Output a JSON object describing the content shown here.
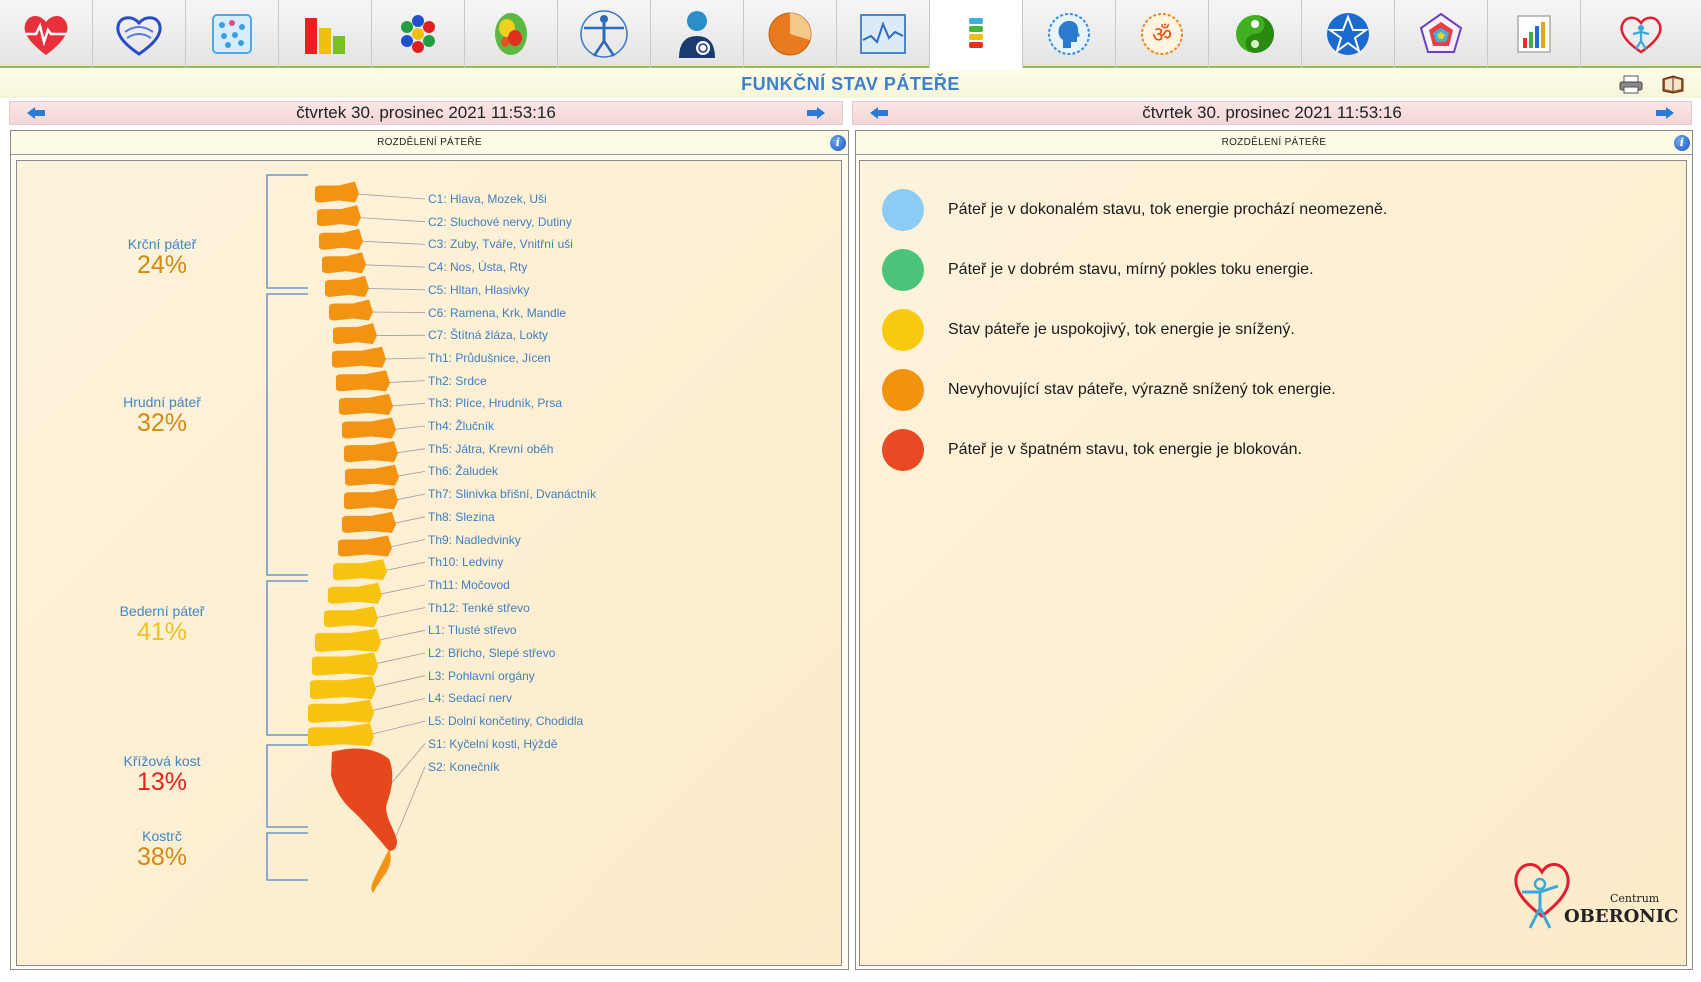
{
  "header": {
    "title": "FUNKČNÍ STAV PÁTEŘE"
  },
  "toolbar": {
    "icons": [
      "heart-pulse-icon",
      "heart-waves-icon",
      "cells-icon",
      "bar-chart-icon",
      "hexagons-icon",
      "brain-map-icon",
      "vitruvian-man-icon",
      "person-scan-icon",
      "pie-chart-icon",
      "monitor-wave-icon",
      "spine-icon",
      "head-profile-icon",
      "om-icon",
      "yin-yang-icon",
      "pentagram-icon",
      "pentagon-chart-icon",
      "column-chart-icon",
      "oberonic-logo-icon"
    ],
    "active_index": 10
  },
  "left": {
    "date": "čtvrtek 30. prosinec 2021 11:53:16",
    "panel_title": "ROZDĚLENÍ PÁTEŘE",
    "sections": [
      {
        "name": "Krční páteř",
        "pct": "24%",
        "color": "#d38a10"
      },
      {
        "name": "Hrudní páteř",
        "pct": "32%",
        "color": "#d38a10"
      },
      {
        "name": "Bederní páteř",
        "pct": "41%",
        "color": "#f0c020"
      },
      {
        "name": "Křížová kost",
        "pct": "13%",
        "color": "#e8221a"
      },
      {
        "name": "Kostrč",
        "pct": "38%",
        "color": "#d38a10"
      }
    ],
    "vertebrae": [
      "C1: Hlava, Mozek, Uši",
      "C2: Sluchové nervy, Dutiny",
      "C3: Zuby, Tváře, Vnitřní uši",
      "C4: Nos, Ústa, Rty",
      "C5: Hltan, Hlasivky",
      "C6: Ramena, Krk, Mandle",
      "C7: Štítná žláza, Lokty",
      "Th1: Průdušnice, Jícen",
      "Th2: Srdce",
      "Th3: Plíce, Hrudník, Prsa",
      "Th4: Žlučník",
      "Th5: Játra, Krevní oběh",
      "Th6: Žaludek",
      "Th7: Slinivka břišní, Dvanáctník",
      "Th8: Slezina",
      "Th9: Nadledvinky",
      "Th10: Ledviny",
      "Th11: Močovod",
      "Th12: Tenké střevo",
      "L1: Tlusté střevo",
      "L2: Břicho, Slepé střevo",
      "L3: Pohlavní orgány",
      "L4: Sedací nerv",
      "L5: Dolní končetiny, Chodidla",
      "S1: Kyčelní kosti, Hýždě",
      "S2: Konečník"
    ],
    "vertebra_levels": [
      "orange",
      "orange",
      "orange",
      "orange",
      "orange",
      "orange",
      "orange",
      "orange",
      "orange",
      "orange",
      "orange",
      "orange",
      "orange",
      "orange",
      "orange",
      "orange",
      "yellow",
      "yellow",
      "yellow",
      "yellow",
      "yellow",
      "yellow",
      "yellow",
      "yellow"
    ],
    "colors": {
      "orange": "#f39312",
      "yellow": "#f6c410",
      "red": "#e5481c"
    }
  },
  "right": {
    "date": "čtvrtek 30. prosinec 2021 11:53:16",
    "panel_title": "ROZDĚLENÍ PÁTEŘE",
    "legend": [
      {
        "color": "#8cccf4",
        "text": "Páteř je v dokonalém stavu, tok energie prochází neomezeně."
      },
      {
        "color": "#4cc37a",
        "text": "Páteř je v dobrém stavu, mírný pokles toku energie."
      },
      {
        "color": "#f7c90f",
        "text": "Stav páteře je uspokojivý, tok energie je snížený."
      },
      {
        "color": "#f2930f",
        "text": "Nevyhovující stav páteře, výrazně snížený tok energie."
      },
      {
        "color": "#e84a24",
        "text": "Páteř je v špatném stavu, tok energie je blokován."
      }
    ],
    "logo_small": "Centrum",
    "logo_big": "OBERONIC"
  }
}
